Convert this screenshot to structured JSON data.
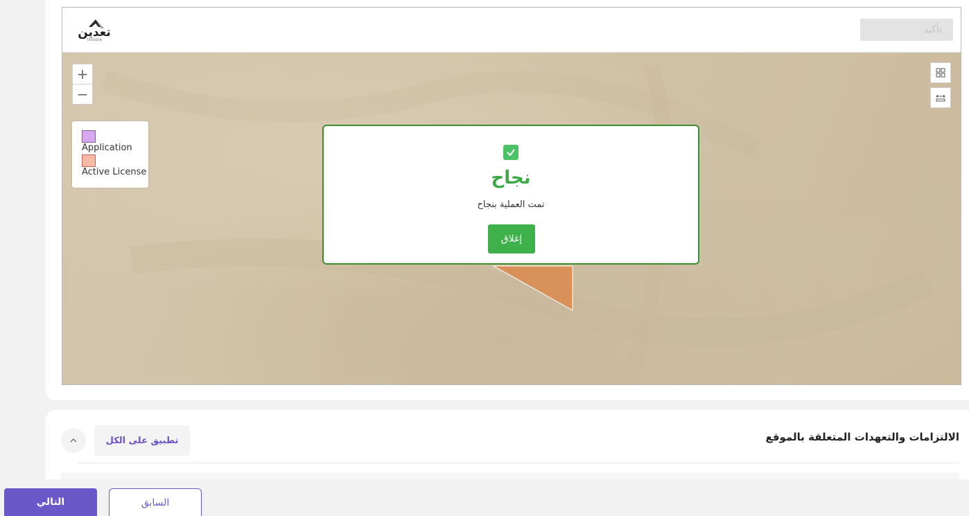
{
  "header": {
    "logo_text": "تعدين",
    "logo_subtext": "TAADEEN",
    "confirm_label": "تأكيد"
  },
  "map": {
    "zoom_in": "+",
    "zoom_out": "−",
    "legend": [
      {
        "label": "Application",
        "color": "#d6a8f0"
      },
      {
        "label": "Active License",
        "color": "#f6b9a6"
      }
    ],
    "feature_color": "#d9915a"
  },
  "modal": {
    "title": "نجاح",
    "message": "تمت العملية بنجاح",
    "close_label": "إغلاق",
    "accent": "#3aa843"
  },
  "section": {
    "title": "الالتزامات والتعهدات المتعلقة بالموقع",
    "apply_all_label": "تطبيق على الكل"
  },
  "footer": {
    "next_label": "التالي",
    "prev_label": "السابق",
    "brand_color": "#6b58c8"
  }
}
